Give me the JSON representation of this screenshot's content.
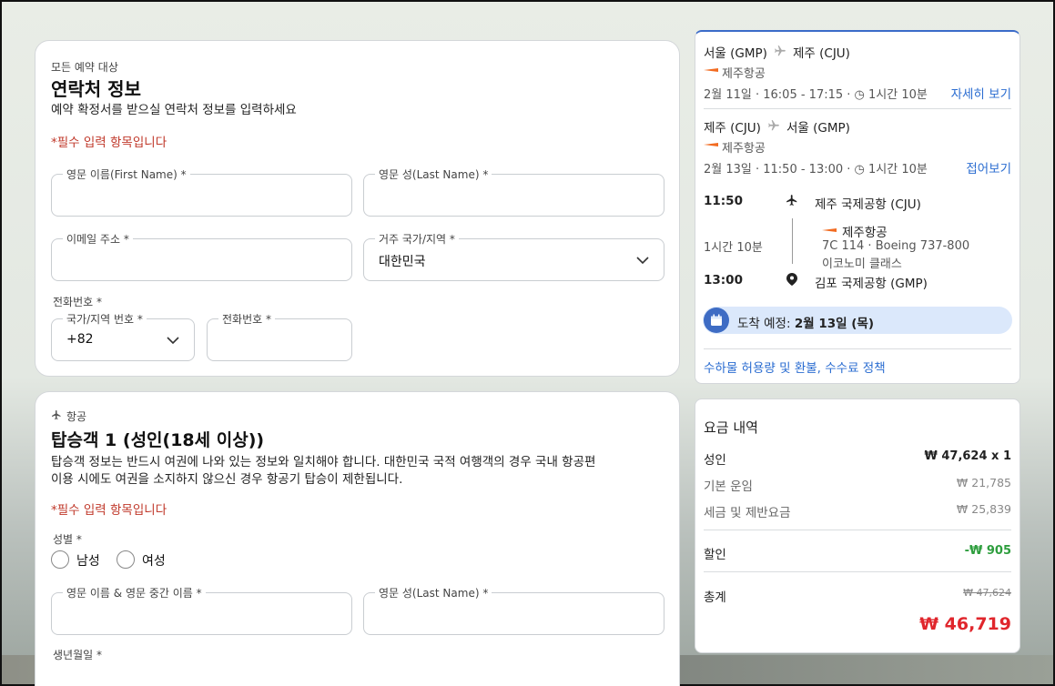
{
  "contact": {
    "eyebrow": "모든 예약 대상",
    "title": "연락처 정보",
    "description": "예약 확정서를 받으실 연락처 정보를 입력하세요",
    "required_note": "*필수 입력 항목입니다",
    "first_name_label": "영문 이름(First Name) *",
    "last_name_label": "영문 성(Last Name) *",
    "email_label": "이메일 주소 *",
    "country_label": "거주 국가/지역 *",
    "country_value": "대한민국",
    "phone_section_label": "전화번호 *",
    "country_code_label": "국가/지역 번호 *",
    "country_code_value": "+82",
    "phone_label": "전화번호 *"
  },
  "passenger": {
    "eyebrow": "항공",
    "title": "탑승객 1 (성인(18세 이상))",
    "description_line1": "탑승객 정보는 반드시 여권에 나와 있는 정보와 일치해야 합니다. 대한민국 국적 여행객의 경우 국내 항공편",
    "description_line2": "이용 시에도 여권을 소지하지 않으신 경우 항공기 탑승이 제한됩니다.",
    "required_note": "*필수 입력 항목입니다",
    "gender_label": "성별 *",
    "male": "남성",
    "female": "여성",
    "first_middle_label": "영문 이름 & 영문 중간 이름 *",
    "last_name_label": "영문 성(Last Name) *",
    "birth_label": "생년월일 *"
  },
  "flight": {
    "outbound": {
      "from": "서울 (GMP)",
      "to": "제주 (CJU)",
      "airline": "제주항공",
      "details": "2월 11일 · 16:05 - 17:15 · ",
      "duration": "1시간 10분",
      "link": "자세히 보기"
    },
    "inbound": {
      "from": "제주 (CJU)",
      "to": "서울 (GMP)",
      "airline": "제주항공",
      "details": "2월 13일 · 11:50 - 13:00 · ",
      "duration": "1시간 10분",
      "link": "접어보기"
    },
    "segment": {
      "dep_time": "11:50",
      "dep_airport": "제주 국제공항 (CJU)",
      "duration": "1시간 10분",
      "airline": "제주항공",
      "flight_info": "7C 114 · Boeing 737-800",
      "cabin": "이코노미 클래스",
      "arr_time": "13:00",
      "arr_airport": "김포 국제공항 (GMP)"
    },
    "arrival_label": "도착 예정: ",
    "arrival_date": "2월 13일 (목)",
    "policy_link": "수하물 허용량 및 환불, 수수료 정책"
  },
  "fare": {
    "title": "요금 내역",
    "adult_label": "성인",
    "adult_value": "₩ 47,624 x 1",
    "base_label": "기본 운임",
    "base_value": "₩ 21,785",
    "tax_label": "세금 및 제반요금",
    "tax_value": "₩ 25,839",
    "discount_label": "할인",
    "discount_value": "-₩ 905",
    "total_label": "총계",
    "original_total": "₩ 47,624",
    "total_value": "₩ 46,719",
    "colors": {
      "discount": "#2e9e3e",
      "total": "#e0262c",
      "link": "#2b6dd1"
    }
  }
}
